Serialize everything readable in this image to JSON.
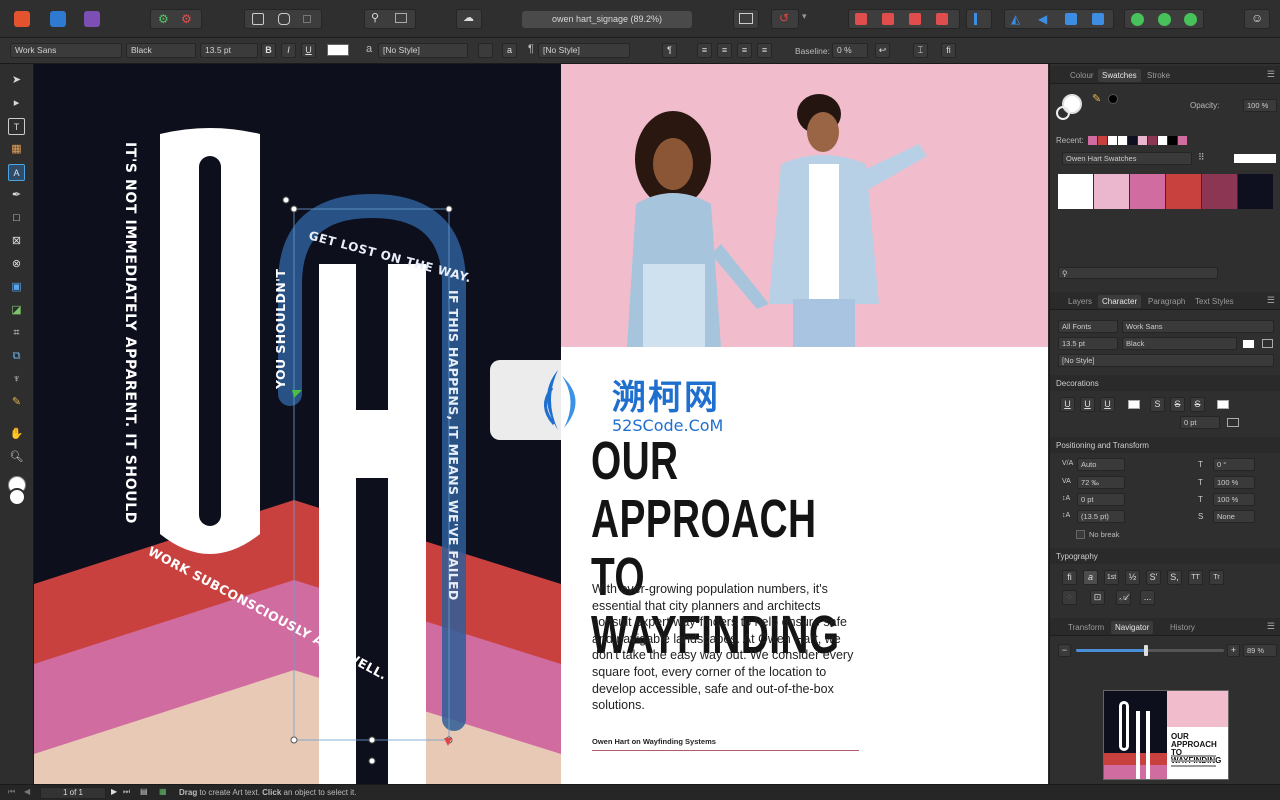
{
  "document": {
    "title": "owen hart_signage (89.2%)"
  },
  "context_toolbar": {
    "font_family": "Work Sans",
    "font_style": "Black",
    "font_size": "13.5 pt",
    "bold": "B",
    "italic": "I",
    "underline": "U",
    "char_style_glyph": "a",
    "char_style": "[No Style]",
    "para_style_glyph": "a",
    "para_style": "[No Style]",
    "pilcrow": "¶",
    "baseline_label": "Baseline:",
    "baseline_value": "0 %",
    "fi_label": "fi"
  },
  "artwork": {
    "arc_text": "IT'S NOT IMMEDIATELY APPARENT. IT SHOULD WORK SUBCONSCIOUSLY AND WELL. YOU SHOULDN'T GET LOST ON THE WAY. IF THIS HAPPENS, IT MEANS WE'VE FAILED",
    "left_vertical_text": "IT'S NOT IMMEDIATELY APPARENT. IT SHOULD",
    "bottom_curve_text": "WORK SUBCONSCIOUSLY AND WELL.",
    "mid_vertical_text": "YOU SHOULDN'T",
    "top_arc_text": "GET LOST ON THE WAY.",
    "right_vertical_text": "IF THIS HAPPENS, IT MEANS WE'VE FAILED",
    "big_letter_1": "O",
    "big_letter_2": "H",
    "heading": "OUR APPROACH TO WAYFINDING",
    "heading_line1": "OUR APPROACH",
    "heading_line2": "TO WAYFINDING",
    "body": "With ever-growing population numbers, it's essential that city planners and architects consult expert way-finders to help ensure safe and navigable landscapes. At Owen Hart, we don't take the easy way out. We consider every square foot, every corner of the location to develop accessible, safe and out-of-the-box solutions.",
    "caption": "Owen Hart on Wayfinding Systems"
  },
  "watermark": {
    "title": "溯柯网",
    "url": "52SCode.CoM"
  },
  "panel": {
    "tabs_top": [
      "Colour",
      "Swatches",
      "Stroke"
    ],
    "opacity_label": "Opacity:",
    "opacity_value": "100 %",
    "recent_label": "Recent:",
    "palette": "Owen Hart Swatches",
    "swatches": [
      "#ffffff",
      "#ebb7cf",
      "#d16ca0",
      "#c9413f",
      "#8c3653",
      "#0e1020"
    ],
    "recent": [
      "#d16ca0",
      "#c9413f",
      "#ffffff",
      "#ffffff",
      "#0e1020",
      "#ebb7cf",
      "#8c3653",
      "#ffffff",
      "#000000",
      "#d16ca0"
    ],
    "tabs_mid": [
      "Layers",
      "Character",
      "Paragraph",
      "Text Styles"
    ],
    "char": {
      "font_collection": "All Fonts",
      "font_family": "Work Sans",
      "size": "13.5 pt",
      "weight": "Black",
      "style": "[No Style]"
    },
    "decorations_label": "Decorations",
    "decoration_buttons": [
      "U",
      "U",
      "U",
      "S",
      "S",
      "S"
    ],
    "decoration_value": "0 pt",
    "positioning_label": "Positioning and Transform",
    "pos": {
      "kerning": "Auto",
      "tracking": "72 ‰",
      "baseline": "0 pt",
      "leading": "(13.5 pt)",
      "shear": "0 °",
      "v_scale": "100 %",
      "h_scale": "100 %",
      "case": "None"
    },
    "no_break": "No break",
    "typography_label": "Typography",
    "typography_buttons": [
      "fi",
      "a",
      "1st",
      "½",
      "S'",
      "S,",
      "TT",
      "Tr"
    ],
    "typography_more": "...",
    "tabs_bottom": [
      "Transform",
      "Navigator",
      "History"
    ],
    "zoom_value": "89 %",
    "zoom_fraction": 0.47
  },
  "status": {
    "page": "1 of 1",
    "hint_drag": "Drag",
    "hint_1": " to create Art text. ",
    "hint_click": "Click",
    "hint_2": " an object to select it."
  }
}
